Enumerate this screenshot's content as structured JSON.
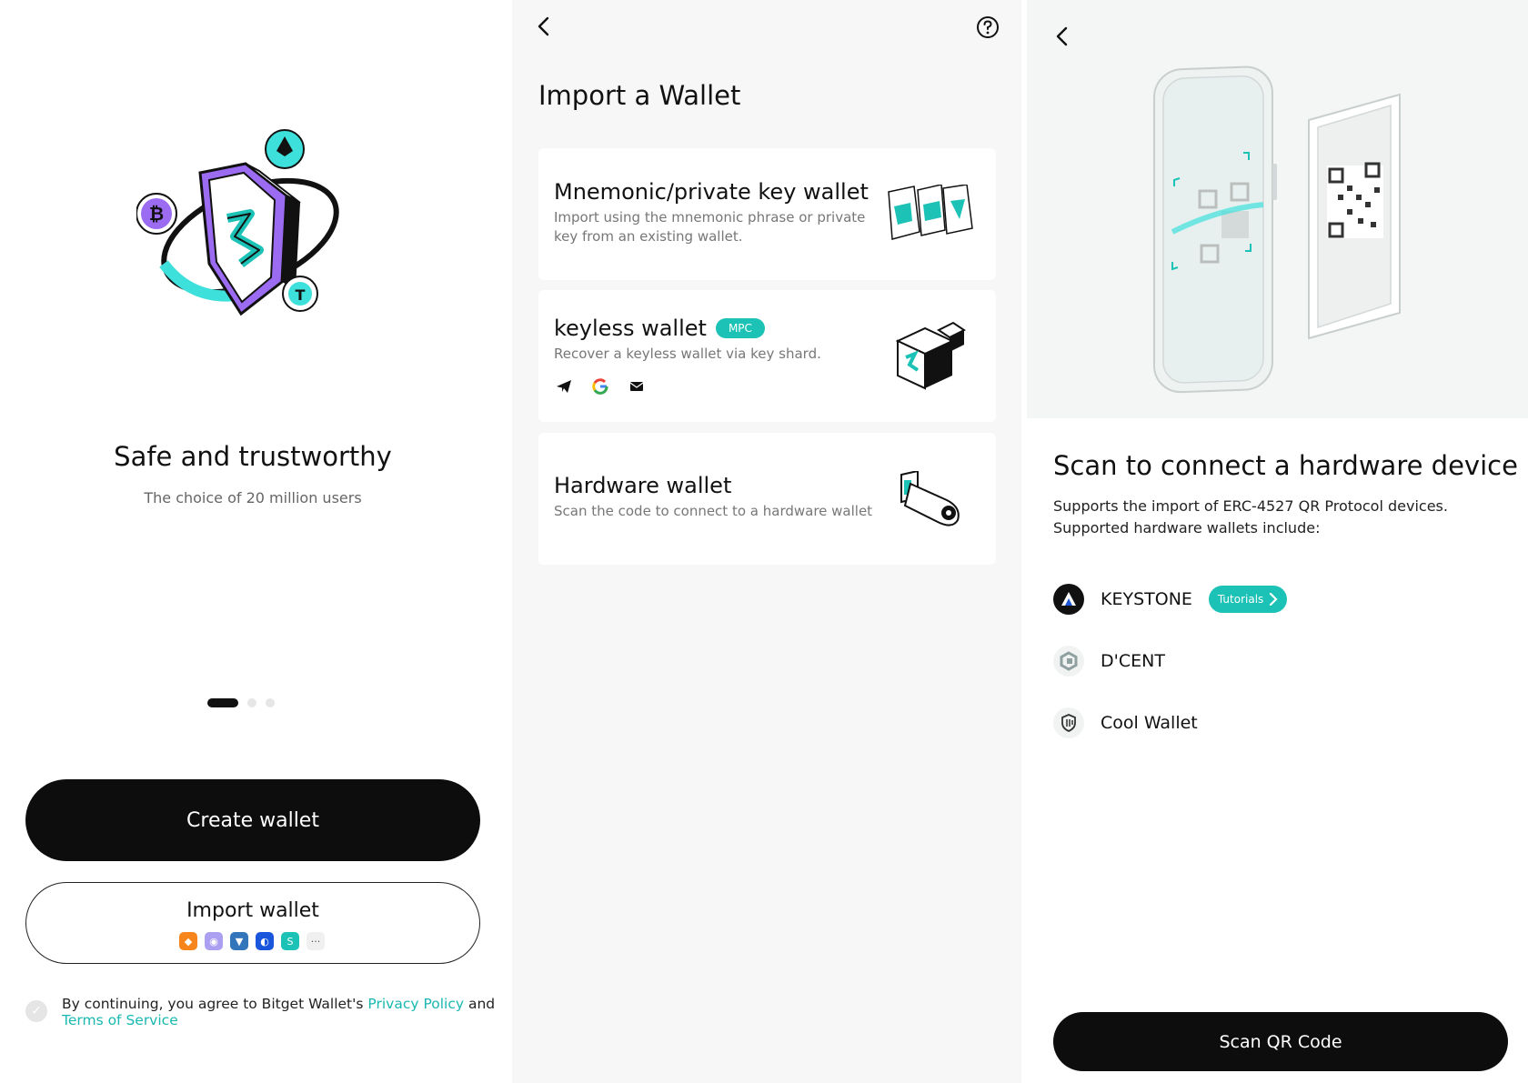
{
  "welcome": {
    "title": "Safe and trustworthy",
    "subtitle": "The choice of 20 million users",
    "carousel": {
      "count": 3,
      "active": 1
    },
    "create_label": "Create wallet",
    "import_label": "Import wallet",
    "wallet_icons": [
      "metamask-icon",
      "phantom-icon",
      "trust-wallet-icon",
      "safepal-icon",
      "bitget-icon",
      "more-icon"
    ],
    "more_glyph": "···",
    "agree_prefix": "By continuing, you agree to Bitget Wallet's ",
    "privacy_label": "Privacy Policy",
    "agree_and": " and",
    "terms_label": "Terms of Service"
  },
  "import": {
    "title": "Import a Wallet",
    "options": [
      {
        "title": "Mnemonic/private key wallet",
        "desc": "Import using the mnemonic phrase or private key from an existing wallet."
      },
      {
        "title": "keyless wallet",
        "badge": "MPC",
        "desc": "Recover a keyless wallet via key shard.",
        "icons": [
          "telegram-icon",
          "google-icon",
          "email-icon"
        ]
      },
      {
        "title": "Hardware wallet",
        "desc": "Scan the code to connect to a hardware wallet"
      }
    ]
  },
  "hardware": {
    "title": "Scan to connect a hardware device",
    "desc": "Supports the import of ERC-4527 QR Protocol devices. Supported hardware wallets include:",
    "devices": [
      {
        "name": "KEYSTONE",
        "tutorial": "Tutorials"
      },
      {
        "name": "D'CENT"
      },
      {
        "name": "Cool Wallet"
      }
    ],
    "scan_label": "Scan QR Code"
  },
  "colors": {
    "accent": "#1cc2b5",
    "dark": "#0d0d0d",
    "purple": "#9b6bf2"
  }
}
